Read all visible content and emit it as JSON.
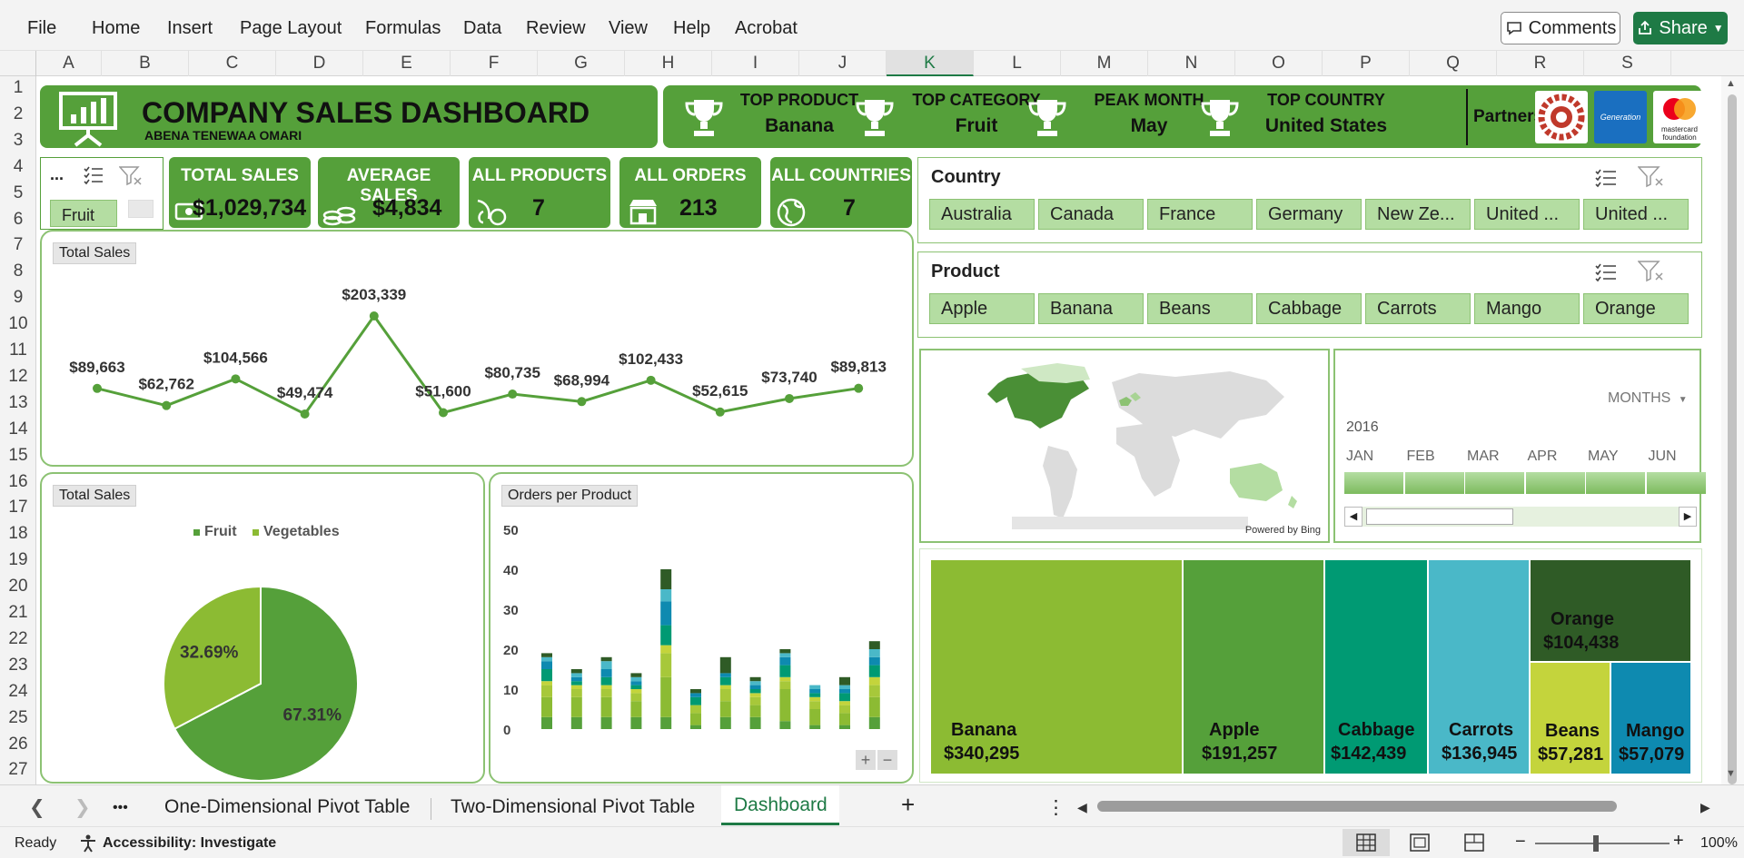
{
  "menu": [
    "File",
    "Home",
    "Insert",
    "Page Layout",
    "Formulas",
    "Data",
    "Review",
    "View",
    "Help",
    "Acrobat"
  ],
  "topbar": {
    "comments_label": "Comments",
    "share_label": "Share"
  },
  "columns": [
    "A",
    "B",
    "C",
    "D",
    "E",
    "F",
    "G",
    "H",
    "I",
    "J",
    "K",
    "L",
    "M",
    "N",
    "O",
    "P",
    "Q",
    "R",
    "S"
  ],
  "selected_column": "K",
  "rows": [
    "1",
    "2",
    "3",
    "4",
    "5",
    "6",
    "7",
    "8",
    "9",
    "10",
    "11",
    "12",
    "13",
    "14",
    "15",
    "16",
    "17",
    "18",
    "19",
    "20",
    "21",
    "22",
    "23",
    "24",
    "25",
    "26",
    "27"
  ],
  "header": {
    "title": "COMPANY SALES DASHBOARD",
    "author": "ABENA TENEWAA OMARI",
    "kpis": [
      {
        "label": "TOP PRODUCT",
        "value": "Banana"
      },
      {
        "label": "TOP CATEGORY",
        "value": "Fruit"
      },
      {
        "label": "PEAK MONTH",
        "value": "May"
      },
      {
        "label": "TOP COUNTRY",
        "value": "United States"
      }
    ],
    "partners_label": "Partners:",
    "partner_logos": [
      {
        "name": "gear-seal-logo",
        "text": ""
      },
      {
        "name": "generation-logo",
        "text": "Generation"
      },
      {
        "name": "mastercard-foundation-logo",
        "text": "mastercard foundation"
      }
    ]
  },
  "mini_slicer": {
    "title": "...",
    "item": "Fruit"
  },
  "stats": [
    {
      "label": "TOTAL SALES",
      "value": "$1,029,734",
      "icon": "money-icon"
    },
    {
      "label": "AVERAGE SALES",
      "value": "$4,834",
      "icon": "coins-icon"
    },
    {
      "label": "ALL PRODUCTS",
      "value": "7",
      "icon": "produce-icon"
    },
    {
      "label": "ALL ORDERS",
      "value": "213",
      "icon": "store-icon"
    },
    {
      "label": "ALL COUNTRIES",
      "value": "7",
      "icon": "globe-icon"
    }
  ],
  "slicers": {
    "country": {
      "title": "Country",
      "items": [
        "Australia",
        "Canada",
        "France",
        "Germany",
        "New Ze...",
        "United ...",
        "United ..."
      ]
    },
    "product": {
      "title": "Product",
      "items": [
        "Apple",
        "Banana",
        "Beans",
        "Cabbage",
        "Carrots",
        "Mango",
        "Orange"
      ]
    }
  },
  "map": {
    "credit": "Powered by Bing"
  },
  "timeline": {
    "period_label": "MONTHS",
    "year": "2016",
    "months": [
      "JAN",
      "FEB",
      "MAR",
      "APR",
      "MAY",
      "JUN"
    ]
  },
  "line_panel": {
    "tag": "Total Sales"
  },
  "pie_panel": {
    "tag": "Total Sales"
  },
  "bar_panel": {
    "tag": "Orders per Product"
  },
  "colors": {
    "fruit": "#55a03a",
    "vegetables": "#8cbb33",
    "banner": "#55a03a"
  },
  "chart_data": [
    {
      "type": "line",
      "title": "Total Sales",
      "values": [
        89663,
        62762,
        104566,
        49474,
        203339,
        51600,
        80735,
        68994,
        102433,
        52615,
        73740,
        89813
      ],
      "labels": [
        "$89,663",
        "$62,762",
        "$104,566",
        "$49,474",
        "$203,339",
        "$51,600",
        "$80,735",
        "$68,994",
        "$102,433",
        "$52,615",
        "$73,740",
        "$89,813"
      ],
      "color": "#55a03a"
    },
    {
      "type": "pie",
      "title": "Total Sales",
      "legend": [
        "Fruit",
        "Vegetables"
      ],
      "values": [
        67.31,
        32.69
      ],
      "labels": [
        "67.31%",
        "32.69%"
      ],
      "colors": [
        "#55a03a",
        "#8cbb33"
      ]
    },
    {
      "type": "bar",
      "title": "Orders per Product",
      "ylim": [
        0,
        50
      ],
      "yticks": [
        "50",
        "40",
        "30",
        "20",
        "10",
        "0"
      ],
      "stacked": true,
      "series": [
        {
          "color": "#55a03a",
          "values": [
            3,
            3,
            3,
            3,
            3,
            1,
            3,
            3,
            2,
            1,
            1,
            3
          ]
        },
        {
          "color": "#8cbb33",
          "values": [
            5,
            5,
            5,
            4,
            10,
            3,
            4,
            3,
            8,
            4,
            3,
            5
          ]
        },
        {
          "color": "#a7c83a",
          "values": [
            3,
            2,
            2,
            2,
            6,
            2,
            3,
            2,
            2,
            2,
            2,
            3
          ]
        },
        {
          "color": "#c4d43c",
          "values": [
            1,
            1,
            1,
            1,
            2,
            0,
            1,
            1,
            1,
            1,
            1,
            2
          ]
        },
        {
          "color": "#009a73",
          "values": [
            3,
            1,
            2,
            1,
            5,
            2,
            2,
            1,
            3,
            1,
            2,
            3
          ]
        },
        {
          "color": "#0e8ab0",
          "values": [
            2,
            1,
            2,
            1,
            6,
            1,
            1,
            1,
            2,
            1,
            1,
            2
          ]
        },
        {
          "color": "#4ab8c8",
          "values": [
            1,
            1,
            2,
            1,
            3,
            0,
            0,
            1,
            1,
            1,
            1,
            2
          ]
        },
        {
          "color": "#2f5b26",
          "values": [
            1,
            1,
            1,
            1,
            5,
            1,
            4,
            1,
            1,
            0,
            2,
            2
          ]
        }
      ]
    },
    {
      "type": "treemap",
      "items": [
        {
          "name": "Banana",
          "label": "$340,295",
          "value": 340295,
          "color": "#8cbb33"
        },
        {
          "name": "Apple",
          "label": "$191,257",
          "value": 191257,
          "color": "#55a03a"
        },
        {
          "name": "Cabbage",
          "label": "$142,439",
          "value": 142439,
          "color": "#009a73"
        },
        {
          "name": "Carrots",
          "label": "$136,945",
          "value": 136945,
          "color": "#4ab8c8"
        },
        {
          "name": "Orange",
          "label": "$104,438",
          "value": 104438,
          "color": "#2f5b26"
        },
        {
          "name": "Beans",
          "label": "$57,281",
          "value": 57281,
          "color": "#c4d43c"
        },
        {
          "name": "Mango",
          "label": "$57,079",
          "value": 57079,
          "color": "#0e8ab0"
        }
      ]
    }
  ],
  "sheet_tabs": {
    "tabs": [
      "One-Dimensional Pivot Table",
      "Two-Dimensional Pivot Table",
      "Dashboard"
    ],
    "active": "Dashboard",
    "more": "•••",
    "add": "+",
    "options": "⋮"
  },
  "status": {
    "ready": "Ready",
    "accessibility": "Accessibility: Investigate",
    "zoom": "100%",
    "minus": "−",
    "plus": "+"
  }
}
